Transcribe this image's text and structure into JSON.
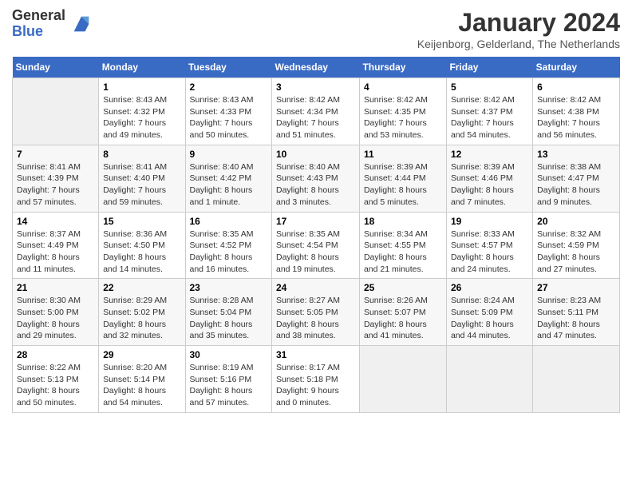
{
  "logo": {
    "general": "General",
    "blue": "Blue"
  },
  "header": {
    "month_year": "January 2024",
    "location": "Keijenborg, Gelderland, The Netherlands"
  },
  "weekdays": [
    "Sunday",
    "Monday",
    "Tuesday",
    "Wednesday",
    "Thursday",
    "Friday",
    "Saturday"
  ],
  "weeks": [
    [
      {
        "day": "",
        "info": ""
      },
      {
        "day": "1",
        "info": "Sunrise: 8:43 AM\nSunset: 4:32 PM\nDaylight: 7 hours\nand 49 minutes."
      },
      {
        "day": "2",
        "info": "Sunrise: 8:43 AM\nSunset: 4:33 PM\nDaylight: 7 hours\nand 50 minutes."
      },
      {
        "day": "3",
        "info": "Sunrise: 8:42 AM\nSunset: 4:34 PM\nDaylight: 7 hours\nand 51 minutes."
      },
      {
        "day": "4",
        "info": "Sunrise: 8:42 AM\nSunset: 4:35 PM\nDaylight: 7 hours\nand 53 minutes."
      },
      {
        "day": "5",
        "info": "Sunrise: 8:42 AM\nSunset: 4:37 PM\nDaylight: 7 hours\nand 54 minutes."
      },
      {
        "day": "6",
        "info": "Sunrise: 8:42 AM\nSunset: 4:38 PM\nDaylight: 7 hours\nand 56 minutes."
      }
    ],
    [
      {
        "day": "7",
        "info": "Sunrise: 8:41 AM\nSunset: 4:39 PM\nDaylight: 7 hours\nand 57 minutes."
      },
      {
        "day": "8",
        "info": "Sunrise: 8:41 AM\nSunset: 4:40 PM\nDaylight: 7 hours\nand 59 minutes."
      },
      {
        "day": "9",
        "info": "Sunrise: 8:40 AM\nSunset: 4:42 PM\nDaylight: 8 hours\nand 1 minute."
      },
      {
        "day": "10",
        "info": "Sunrise: 8:40 AM\nSunset: 4:43 PM\nDaylight: 8 hours\nand 3 minutes."
      },
      {
        "day": "11",
        "info": "Sunrise: 8:39 AM\nSunset: 4:44 PM\nDaylight: 8 hours\nand 5 minutes."
      },
      {
        "day": "12",
        "info": "Sunrise: 8:39 AM\nSunset: 4:46 PM\nDaylight: 8 hours\nand 7 minutes."
      },
      {
        "day": "13",
        "info": "Sunrise: 8:38 AM\nSunset: 4:47 PM\nDaylight: 8 hours\nand 9 minutes."
      }
    ],
    [
      {
        "day": "14",
        "info": "Sunrise: 8:37 AM\nSunset: 4:49 PM\nDaylight: 8 hours\nand 11 minutes."
      },
      {
        "day": "15",
        "info": "Sunrise: 8:36 AM\nSunset: 4:50 PM\nDaylight: 8 hours\nand 14 minutes."
      },
      {
        "day": "16",
        "info": "Sunrise: 8:35 AM\nSunset: 4:52 PM\nDaylight: 8 hours\nand 16 minutes."
      },
      {
        "day": "17",
        "info": "Sunrise: 8:35 AM\nSunset: 4:54 PM\nDaylight: 8 hours\nand 19 minutes."
      },
      {
        "day": "18",
        "info": "Sunrise: 8:34 AM\nSunset: 4:55 PM\nDaylight: 8 hours\nand 21 minutes."
      },
      {
        "day": "19",
        "info": "Sunrise: 8:33 AM\nSunset: 4:57 PM\nDaylight: 8 hours\nand 24 minutes."
      },
      {
        "day": "20",
        "info": "Sunrise: 8:32 AM\nSunset: 4:59 PM\nDaylight: 8 hours\nand 27 minutes."
      }
    ],
    [
      {
        "day": "21",
        "info": "Sunrise: 8:30 AM\nSunset: 5:00 PM\nDaylight: 8 hours\nand 29 minutes."
      },
      {
        "day": "22",
        "info": "Sunrise: 8:29 AM\nSunset: 5:02 PM\nDaylight: 8 hours\nand 32 minutes."
      },
      {
        "day": "23",
        "info": "Sunrise: 8:28 AM\nSunset: 5:04 PM\nDaylight: 8 hours\nand 35 minutes."
      },
      {
        "day": "24",
        "info": "Sunrise: 8:27 AM\nSunset: 5:05 PM\nDaylight: 8 hours\nand 38 minutes."
      },
      {
        "day": "25",
        "info": "Sunrise: 8:26 AM\nSunset: 5:07 PM\nDaylight: 8 hours\nand 41 minutes."
      },
      {
        "day": "26",
        "info": "Sunrise: 8:24 AM\nSunset: 5:09 PM\nDaylight: 8 hours\nand 44 minutes."
      },
      {
        "day": "27",
        "info": "Sunrise: 8:23 AM\nSunset: 5:11 PM\nDaylight: 8 hours\nand 47 minutes."
      }
    ],
    [
      {
        "day": "28",
        "info": "Sunrise: 8:22 AM\nSunset: 5:13 PM\nDaylight: 8 hours\nand 50 minutes."
      },
      {
        "day": "29",
        "info": "Sunrise: 8:20 AM\nSunset: 5:14 PM\nDaylight: 8 hours\nand 54 minutes."
      },
      {
        "day": "30",
        "info": "Sunrise: 8:19 AM\nSunset: 5:16 PM\nDaylight: 8 hours\nand 57 minutes."
      },
      {
        "day": "31",
        "info": "Sunrise: 8:17 AM\nSunset: 5:18 PM\nDaylight: 9 hours\nand 0 minutes."
      },
      {
        "day": "",
        "info": ""
      },
      {
        "day": "",
        "info": ""
      },
      {
        "day": "",
        "info": ""
      }
    ]
  ]
}
